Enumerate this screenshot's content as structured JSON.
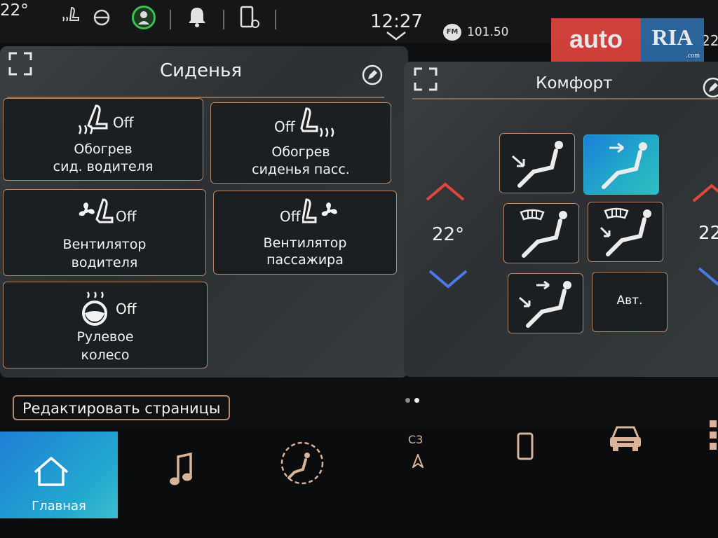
{
  "status_bar": {
    "temperature_left": "22°",
    "time": "12:27",
    "radio_band": "FM",
    "radio_frequency": "101.50",
    "temperature_right": "22",
    "watermark_auto": "auto",
    "watermark_ria": "RIA",
    "watermark_com": ".com"
  },
  "seats_panel": {
    "title": "Сиденья",
    "tiles": [
      {
        "state": "Off",
        "line1": "Обогрев",
        "line2": "сид. водителя"
      },
      {
        "state": "Off",
        "line1": "Обогрев",
        "line2": "сиденья пасс."
      },
      {
        "state": "Off",
        "line1": "Вентилятор",
        "line2": "водителя"
      },
      {
        "state": "Off",
        "line1": "Вентилятор",
        "line2": "пассажира"
      },
      {
        "state": "Off",
        "line1": "Рулевое",
        "line2": "колесо"
      }
    ]
  },
  "comfort_panel": {
    "title": "Комфорт",
    "temperature": "22°",
    "temperature_right_partial": "22",
    "auto_label": "Авт.",
    "active_mode_index": 1
  },
  "page_indicator": {
    "count": 2,
    "active": 1
  },
  "edit_pages_label": "Редактировать страницы",
  "bottom_nav": {
    "home_label": "Главная",
    "nav_label_c3": "C3",
    "items": [
      "home-icon",
      "music-note-icon",
      "climate-fan-icon",
      "navigation-arrow-icon",
      "phone-icon",
      "car-icon",
      "grid-menu-icon"
    ]
  },
  "colors": {
    "accent_copper": "#b3876a",
    "active_blue": "#1f7fd6",
    "temp_up_red": "#e0463c",
    "temp_down_blue": "#4a7ae8",
    "status_green": "#39c24e"
  }
}
